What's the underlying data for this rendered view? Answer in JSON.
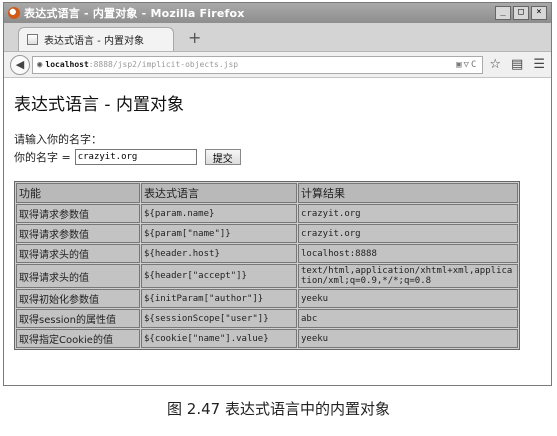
{
  "window": {
    "title": "表达式语言 - 内置对象 - Mozilla Firefox",
    "controls": [
      "_",
      "□",
      "×"
    ]
  },
  "tab": {
    "label": "表达式语言 - 内置对象",
    "new_tab": "+"
  },
  "urlbar": {
    "host": "localhost",
    "path": ":8888/jsp2/implicit-objects.jsp"
  },
  "page": {
    "title": "表达式语言 - 内置对象",
    "prompt": "请输入你的名字：",
    "name_label": "你的名字 =",
    "name_value": "crazyit.org",
    "submit_label": "提交"
  },
  "table": {
    "headers": [
      "功能",
      "表达式语言",
      "计算结果"
    ],
    "rows": [
      [
        "取得请求参数值",
        "${param.name}",
        "crazyit.org"
      ],
      [
        "取得请求参数值",
        "${param[\"name\"]}",
        "crazyit.org"
      ],
      [
        "取得请求头的值",
        "${header.host}",
        "localhost:8888"
      ],
      [
        "取得请求头的值",
        "${header[\"accept\"]}",
        "text/html,application/xhtml+xml,application/xml;q=0.9,*/*;q=0.8"
      ],
      [
        "取得初始化参数值",
        "${initParam[\"author\"]}",
        "yeeku"
      ],
      [
        "取得session的属性值",
        "${sessionScope[\"user\"]}",
        "abc"
      ],
      [
        "取得指定Cookie的值",
        "${cookie[\"name\"].value}",
        "yeeku"
      ]
    ]
  },
  "caption": "图 2.47    表达式语言中的内置对象"
}
